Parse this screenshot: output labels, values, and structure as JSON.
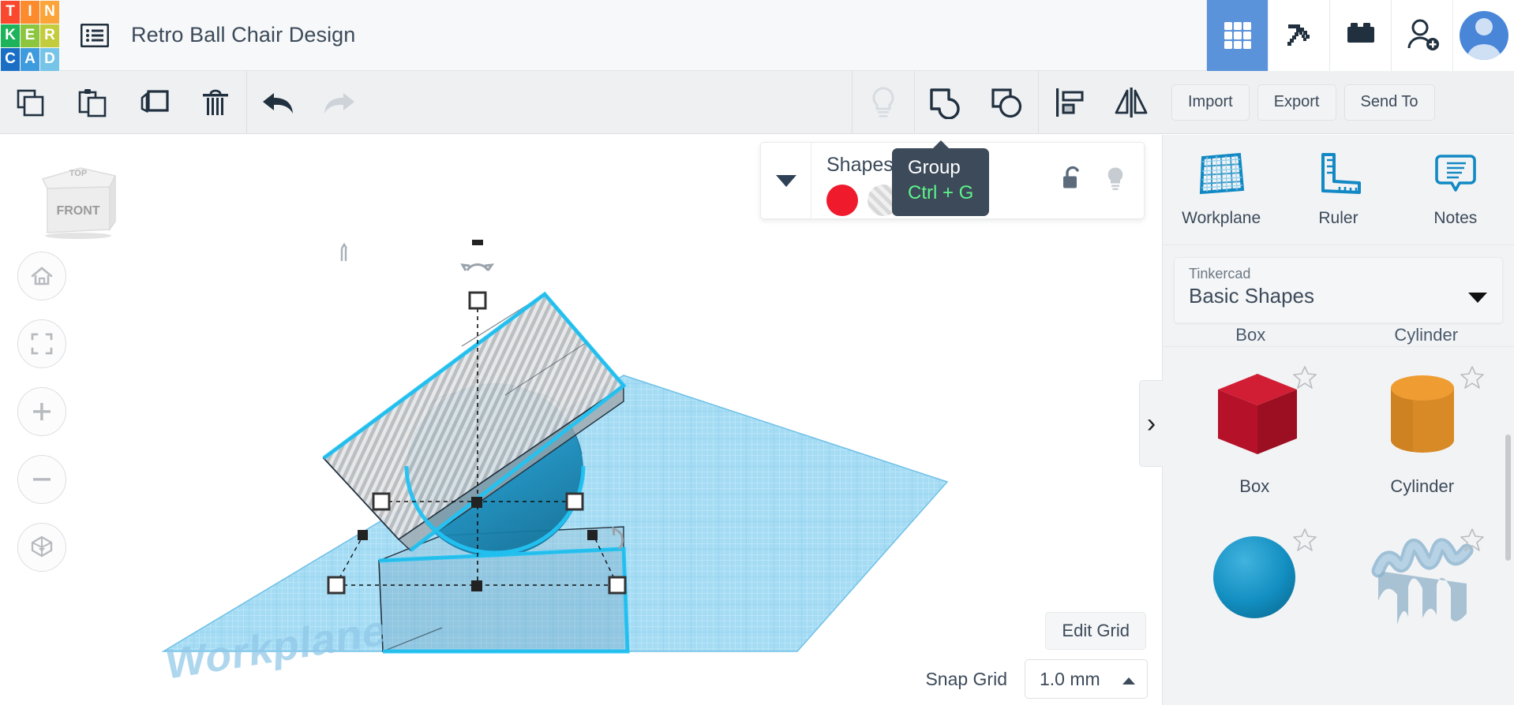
{
  "app": {
    "logo_letters": [
      {
        "ch": "T",
        "color": "#f9482e"
      },
      {
        "ch": "I",
        "color": "#fb8b2c"
      },
      {
        "ch": "N",
        "color": "#fba43a"
      },
      {
        "ch": "K",
        "color": "#1db35a"
      },
      {
        "ch": "E",
        "color": "#8cc63f"
      },
      {
        "ch": "R",
        "color": "#c3cc3c"
      },
      {
        "ch": "C",
        "color": "#1a6fc4"
      },
      {
        "ch": "A",
        "color": "#3e9bdd"
      },
      {
        "ch": "D",
        "color": "#76c4e8"
      }
    ],
    "menu_icon": "list-menu-icon",
    "document_title": "Retro Ball Chair Design"
  },
  "topbar_right": {
    "items": [
      {
        "name": "grid-designs-icon",
        "label": "Designs",
        "active": true
      },
      {
        "name": "minecraft-pickaxe-icon",
        "label": "Minecraft",
        "active": false
      },
      {
        "name": "lego-brick-icon",
        "label": "Blocks",
        "active": false
      },
      {
        "name": "invite-user-icon",
        "label": "Invite",
        "active": false
      }
    ],
    "avatar": "user-avatar"
  },
  "toolbar": {
    "left_tools": [
      {
        "name": "copy-icon",
        "label": "Copy",
        "disabled": false
      },
      {
        "name": "paste-icon",
        "label": "Paste",
        "disabled": false
      },
      {
        "name": "duplicate-icon",
        "label": "Duplicate",
        "disabled": false
      },
      {
        "name": "delete-trash-icon",
        "label": "Delete",
        "disabled": false
      }
    ],
    "history_tools": [
      {
        "name": "undo-arrow-icon",
        "label": "Undo",
        "disabled": false
      },
      {
        "name": "redo-arrow-icon",
        "label": "Redo",
        "disabled": true
      }
    ],
    "object_tools": [
      {
        "name": "lightbulb-icon",
        "label": "Show all",
        "disabled": true
      },
      {
        "name": "group-icon",
        "label": "Group",
        "disabled": false
      },
      {
        "name": "ungroup-icon",
        "label": "Ungroup",
        "disabled": false
      },
      {
        "name": "align-icon",
        "label": "Align",
        "disabled": false
      },
      {
        "name": "mirror-flip-icon",
        "label": "Mirror",
        "disabled": false
      }
    ],
    "import_label": "Import",
    "export_label": "Export",
    "send_to_label": "Send To"
  },
  "tooltip": {
    "title": "Group",
    "shortcut": "Ctrl + G"
  },
  "inspector": {
    "caret": "chevron-down-icon",
    "title": "Shapes(3)",
    "swatches": [
      {
        "name": "solid-color-swatch",
        "color": "#ef1b2d",
        "type": "solid"
      },
      {
        "name": "hole-swatch",
        "color": "#d8d8d8",
        "type": "hole"
      }
    ],
    "lock_icon": "unlock-icon",
    "visibility_icon": "lightbulb-icon"
  },
  "viewport": {
    "view_cube": {
      "front_label": "FRONT",
      "top_label": "TOP"
    },
    "nav_buttons": [
      {
        "name": "home-view-button",
        "icon": "home-icon"
      },
      {
        "name": "fit-to-view-button",
        "icon": "fit-frame-icon"
      },
      {
        "name": "zoom-in-button",
        "icon": "plus-icon"
      },
      {
        "name": "zoom-out-button",
        "icon": "minus-icon"
      },
      {
        "name": "perspective-toggle-button",
        "icon": "cube-projection-icon"
      }
    ],
    "workplane_label": "Workplane",
    "edit_grid_label": "Edit Grid",
    "snap_grid_label": "Snap Grid",
    "snap_grid_value": "1.0 mm",
    "snap_grid_caret": "chevron-up-icon",
    "scene_objects": [
      {
        "name": "sphere-object",
        "color": "#1f93c4",
        "type": "sphere",
        "selected": true
      },
      {
        "name": "hole-box-object",
        "color": "#b9bcbf",
        "type": "box-hole",
        "selected": true
      },
      {
        "name": "base-box-object",
        "color": "#6f96ad",
        "type": "box",
        "selected": true
      }
    ],
    "selection_color": "#22c3f3"
  },
  "right_panel": {
    "toggle_icon": "chevron-right-icon",
    "tabs": [
      {
        "name": "workplane-tool",
        "label": "Workplane",
        "icon": "workplane-grid-icon"
      },
      {
        "name": "ruler-tool",
        "label": "Ruler",
        "icon": "ruler-icon"
      },
      {
        "name": "notes-tool",
        "label": "Notes",
        "icon": "notes-bubble-icon"
      }
    ],
    "library": {
      "vendor": "Tinkercad",
      "name": "Basic Shapes",
      "caret": "chevron-down-icon"
    },
    "clipped_row_labels": [
      "Box",
      "Cylinder"
    ],
    "shapes": [
      {
        "name": "shape-box",
        "label": "Box",
        "color": "#c4122e",
        "art": "cube",
        "starred": false
      },
      {
        "name": "shape-cylinder",
        "label": "Cylinder",
        "color": "#e0922f",
        "art": "cylinder",
        "starred": false
      },
      {
        "name": "shape-sphere",
        "label": "",
        "color": "#128ec0",
        "art": "sphere",
        "starred": false
      },
      {
        "name": "shape-scribble",
        "label": "",
        "color": "#9fc0d6",
        "art": "scribble",
        "starred": false
      }
    ]
  }
}
